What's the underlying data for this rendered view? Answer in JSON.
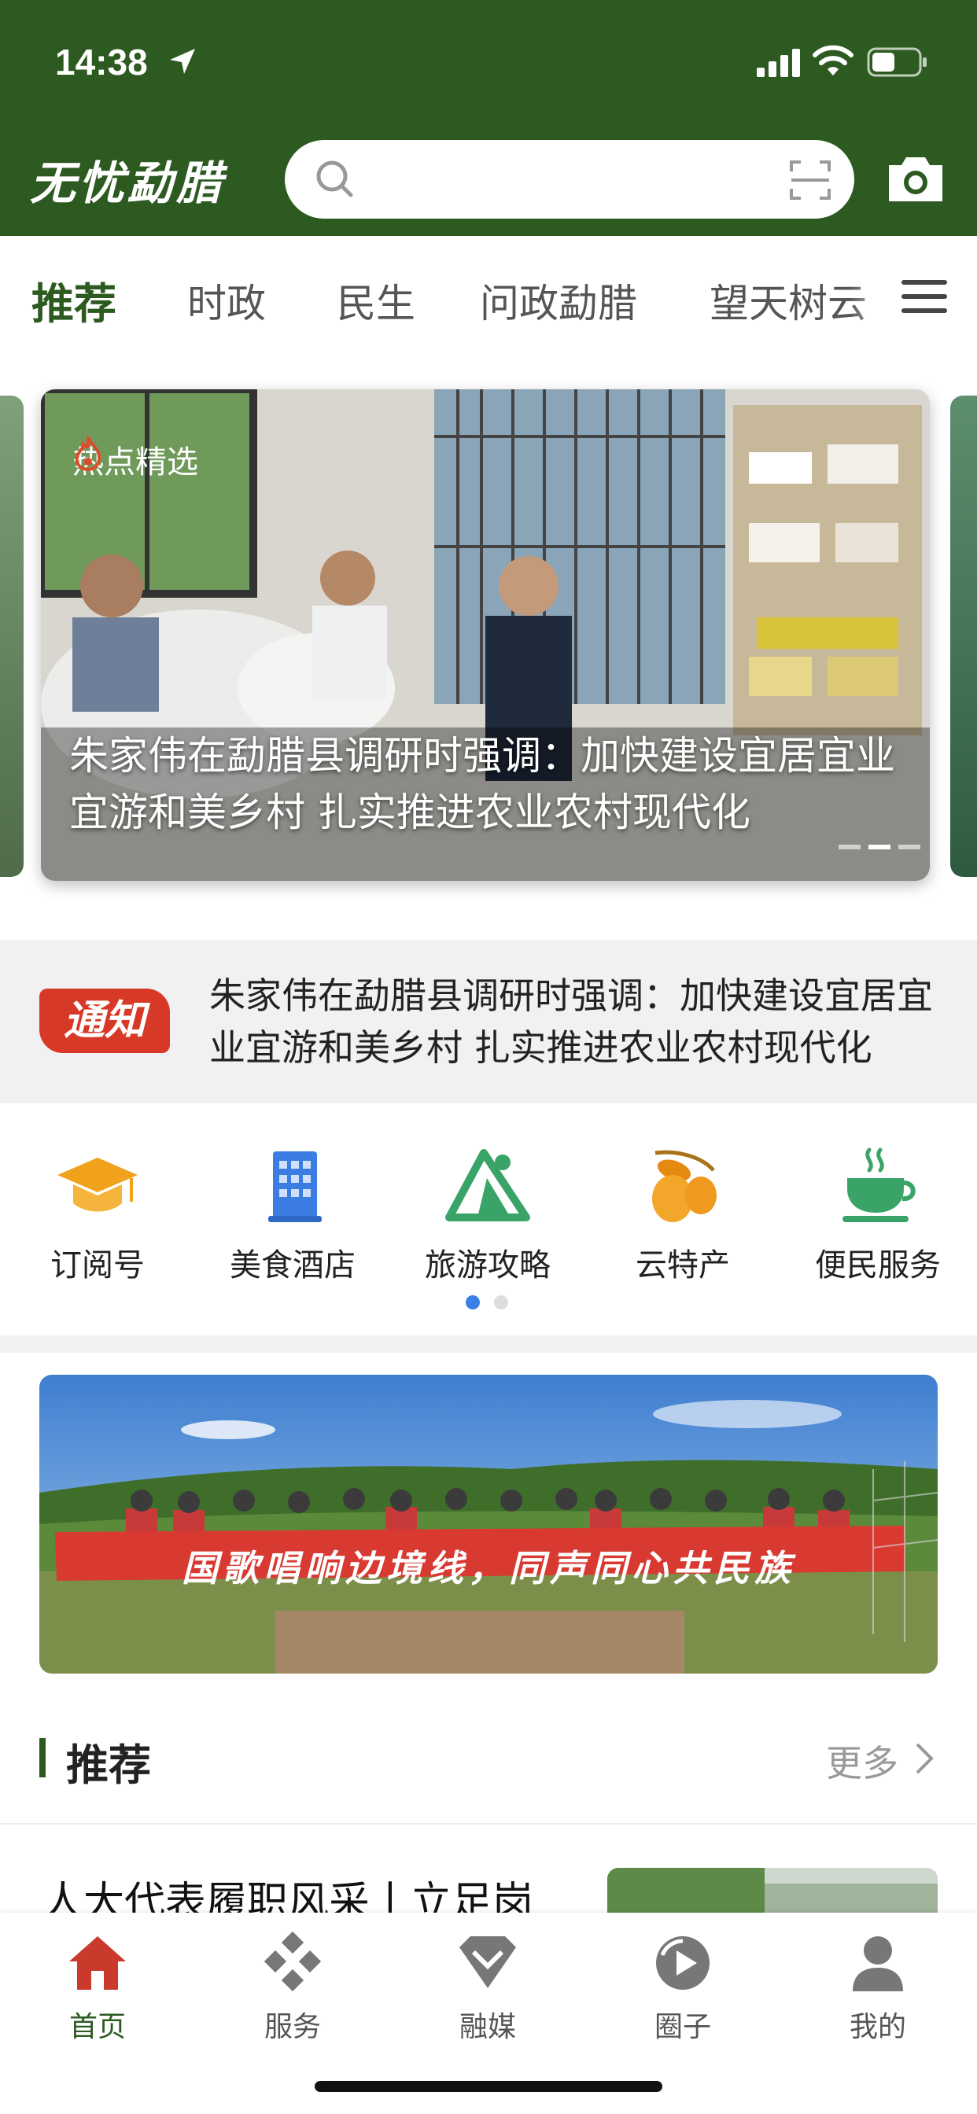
{
  "status_bar": {
    "time": "14:38"
  },
  "header": {
    "logo": "无忧勐腊",
    "search_placeholder": ""
  },
  "tabs": [
    {
      "label": "推荐",
      "active": true
    },
    {
      "label": "时政"
    },
    {
      "label": "民生"
    },
    {
      "label": "问政勐腊"
    },
    {
      "label": "望天树云"
    }
  ],
  "carousel": {
    "tag": "热点精选",
    "title": "朱家伟在勐腊县调研时强调：加快建设宜居宜业宜游和美乡村 扎实推进农业农村现代化"
  },
  "notice": {
    "badge": "通知",
    "text": "朱家伟在勐腊县调研时强调：加快建设宜居宜业宜游和美乡村 扎实推进农业农村现代化"
  },
  "services": [
    {
      "label": "订阅号",
      "icon": "graduation-cap-icon",
      "color": "#f0a21c"
    },
    {
      "label": "美食酒店",
      "icon": "building-icon",
      "color": "#3b7de2"
    },
    {
      "label": "旅游攻略",
      "icon": "mountain-icon",
      "color": "#3aa468"
    },
    {
      "label": "云特产",
      "icon": "olive-icon",
      "color": "#ef9a1e"
    },
    {
      "label": "便民服务",
      "icon": "tea-cup-icon",
      "color": "#3aa468"
    }
  ],
  "banner": {
    "text": "国歌唱响边境线，同声同心共民族"
  },
  "recommend": {
    "title": "推荐",
    "more": "更多",
    "article_title": "人大代表履职风采丨立足岗"
  },
  "bottom_nav": [
    {
      "label": "首页",
      "icon": "home-icon",
      "active": true
    },
    {
      "label": "服务",
      "icon": "services-icon"
    },
    {
      "label": "融媒",
      "icon": "media-icon"
    },
    {
      "label": "圈子",
      "icon": "circle-icon"
    },
    {
      "label": "我的",
      "icon": "profile-icon"
    }
  ],
  "colors": {
    "brand": "#2d5a20",
    "notice_red": "#d63a27",
    "active_dot": "#3a7ee8"
  }
}
